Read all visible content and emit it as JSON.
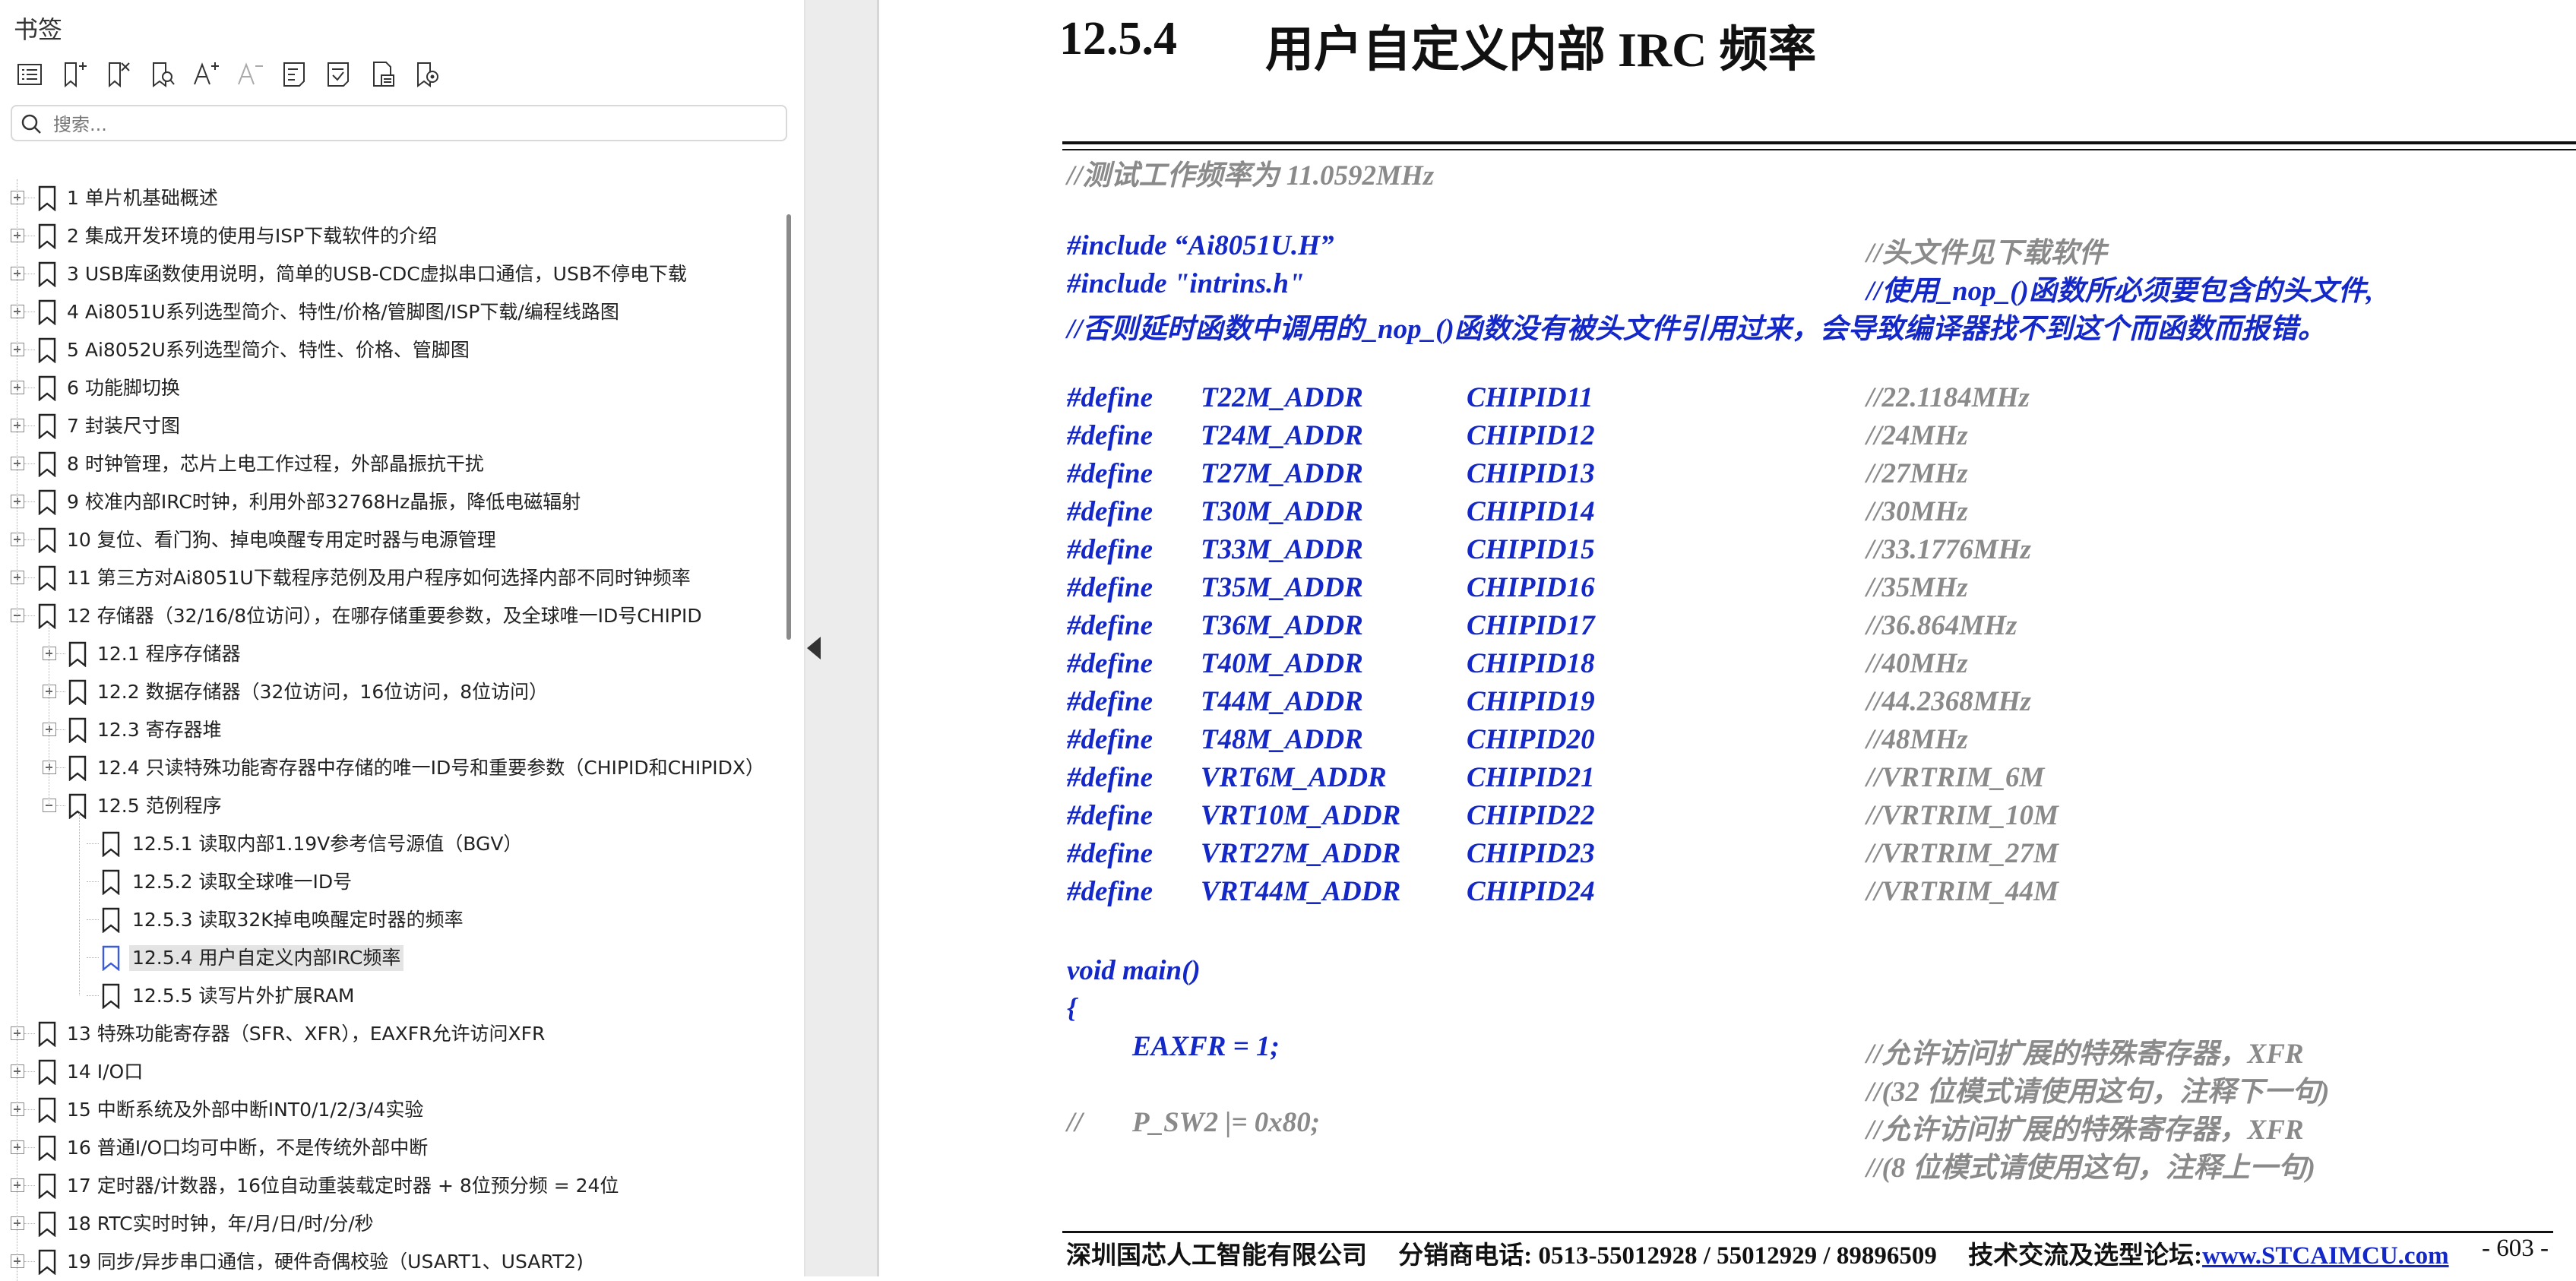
{
  "sidebar": {
    "title": "书签",
    "search_placeholder": "搜索...",
    "toolbar": [
      "bookmark-list-icon",
      "add-bookmark-icon",
      "delete-bookmark-icon",
      "find-bookmark-icon",
      "increase-text-icon",
      "decrease-text-icon",
      "expand-bookmark-icon",
      "collapse-bookmark-icon",
      "bookmark-properties-icon",
      "bookmark-settings-icon"
    ],
    "items": [
      {
        "label": "1  单片机基础概述",
        "level": 0,
        "expander": "plus"
      },
      {
        "label": "2  集成开发环境的使用与ISP下载软件的介绍",
        "level": 0,
        "expander": "plus"
      },
      {
        "label": "3 USB库函数使用说明，简单的USB-CDC虚拟串口通信，USB不停电下载",
        "level": 0,
        "expander": "plus"
      },
      {
        "label": "4  Ai8051U系列选型简介、特性/价格/管脚图/ISP下载/编程线路图",
        "level": 0,
        "expander": "plus"
      },
      {
        "label": "5  Ai8052U系列选型简介、特性、价格、管脚图",
        "level": 0,
        "expander": "plus"
      },
      {
        "label": "6  功能脚切换",
        "level": 0,
        "expander": "plus"
      },
      {
        "label": "7  封装尺寸图",
        "level": 0,
        "expander": "plus"
      },
      {
        "label": "8  时钟管理，芯片上电工作过程，外部晶振抗干扰",
        "level": 0,
        "expander": "plus"
      },
      {
        "label": "9  校准内部IRC时钟，利用外部32768Hz晶振，降低电磁辐射",
        "level": 0,
        "expander": "plus"
      },
      {
        "label": "10  复位、看门狗、掉电唤醒专用定时器与电源管理",
        "level": 0,
        "expander": "plus"
      },
      {
        "label": "11  第三方对Ai8051U下载程序范例及用户程序如何选择内部不同时钟频率",
        "level": 0,
        "expander": "plus"
      },
      {
        "label": "12  存储器（32/16/8位访问），在哪存储重要参数，及全球唯一ID号CHIPID",
        "level": 0,
        "expander": "minus"
      },
      {
        "label": "12.1  程序存储器",
        "level": 1,
        "expander": "plus"
      },
      {
        "label": "12.2  数据存储器（32位访问，16位访问，8位访问）",
        "level": 1,
        "expander": "plus"
      },
      {
        "label": "12.3  寄存器堆",
        "level": 1,
        "expander": "plus"
      },
      {
        "label": "12.4  只读特殊功能寄存器中存储的唯一ID号和重要参数（CHIPID和CHIPIDX）",
        "level": 1,
        "expander": "plus"
      },
      {
        "label": "12.5  范例程序",
        "level": 1,
        "expander": "minus"
      },
      {
        "label": "12.5.1 读取内部1.19V参考信号源值（BGV）",
        "level": 2,
        "expander": "none"
      },
      {
        "label": "12.5.2 读取全球唯一ID号",
        "level": 2,
        "expander": "none"
      },
      {
        "label": "12.5.3 读取32K掉电唤醒定时器的频率",
        "level": 2,
        "expander": "none"
      },
      {
        "label": "12.5.4 用户自定义内部IRC频率",
        "level": 2,
        "expander": "none",
        "selected": true
      },
      {
        "label": "12.5.5 读写片外扩展RAM",
        "level": 2,
        "expander": "none"
      },
      {
        "label": "13  特殊功能寄存器（SFR、XFR），EAXFR允许访问XFR",
        "level": 0,
        "expander": "plus"
      },
      {
        "label": "14  I/O口",
        "level": 0,
        "expander": "plus"
      },
      {
        "label": "15  中断系统及外部中断INT0/1/2/3/4实验",
        "level": 0,
        "expander": "plus"
      },
      {
        "label": "16  普通I/O口均可中断，不是传统外部中断",
        "level": 0,
        "expander": "plus"
      },
      {
        "label": "17  定时器/计数器，16位自动重装载定时器 + 8位预分频 = 24位",
        "level": 0,
        "expander": "plus"
      },
      {
        "label": "18  RTC实时时钟，年/月/日/时/分/秒",
        "level": 0,
        "expander": "plus"
      },
      {
        "label": "19  同步/异步串口通信，硬件奇偶校验（USART1、USART2)",
        "level": 0,
        "expander": "plus"
      }
    ]
  },
  "document": {
    "heading_number": "12.5.4",
    "heading_text": "用户自定义内部 IRC 频率",
    "test_comment": "//测试工作频率为 11.0592MHz",
    "includes": [
      {
        "code": "#include “Ai8051U.H”",
        "comment": "//头文件见下载软件"
      },
      {
        "code": "#include \"intrins.h\"",
        "comment": "//使用_nop_()函数所必须要包含的头文件,"
      }
    ],
    "include_note": "//否则延时函数中调用的_nop_()函数没有被头文件引用过来，会导致编译器找不到这个而函数而报错。",
    "defines": [
      {
        "kw": "#define",
        "name": "T22M_ADDR",
        "value": "CHIPID11",
        "comment": "//22.1184MHz"
      },
      {
        "kw": "#define",
        "name": "T24M_ADDR",
        "value": "CHIPID12",
        "comment": "//24MHz"
      },
      {
        "kw": "#define",
        "name": "T27M_ADDR",
        "value": "CHIPID13",
        "comment": "//27MHz"
      },
      {
        "kw": "#define",
        "name": "T30M_ADDR",
        "value": "CHIPID14",
        "comment": "//30MHz"
      },
      {
        "kw": "#define",
        "name": "T33M_ADDR",
        "value": "CHIPID15",
        "comment": "//33.1776MHz"
      },
      {
        "kw": "#define",
        "name": "T35M_ADDR",
        "value": "CHIPID16",
        "comment": "//35MHz"
      },
      {
        "kw": "#define",
        "name": "T36M_ADDR",
        "value": "CHIPID17",
        "comment": "//36.864MHz"
      },
      {
        "kw": "#define",
        "name": "T40M_ADDR",
        "value": "CHIPID18",
        "comment": "//40MHz"
      },
      {
        "kw": "#define",
        "name": "T44M_ADDR",
        "value": "CHIPID19",
        "comment": "//44.2368MHz"
      },
      {
        "kw": "#define",
        "name": "T48M_ADDR",
        "value": "CHIPID20",
        "comment": "//48MHz"
      },
      {
        "kw": "#define",
        "name": "VRT6M_ADDR",
        "value": "CHIPID21",
        "comment": "//VRTRIM_6M"
      },
      {
        "kw": "#define",
        "name": "VRT10M_ADDR",
        "value": "CHIPID22",
        "comment": "//VRTRIM_10M"
      },
      {
        "kw": "#define",
        "name": "VRT27M_ADDR",
        "value": "CHIPID23",
        "comment": "//VRTRIM_27M"
      },
      {
        "kw": "#define",
        "name": "VRT44M_ADDR",
        "value": "CHIPID24",
        "comment": "//VRTRIM_44M"
      }
    ],
    "main_sig": "void main()",
    "open_brace": "{",
    "eaxfr_code": "EAXFR = 1;",
    "eaxfr_comment": "//允许访问扩展的特殊寄存器，XFR",
    "eaxfr_comment2": "//(32 位模式请使用这句，注释下一句)",
    "psw2_prefix": "//",
    "psw2_code": "P_SW2 |= 0x80;",
    "psw2_comment": "//允许访问扩展的特殊寄存器，XFR",
    "psw2_comment2": "//(8 位模式请使用这句，注释上一句)"
  },
  "footer": {
    "company": "深圳国芯人工智能有限公司",
    "phone": "分销商电话: 0513-55012928 / 55012929 / 89896509",
    "forum_label": "技术交流及选型论坛:",
    "forum_link": "www.STCAIMCU.com",
    "page": "- 603 -"
  }
}
